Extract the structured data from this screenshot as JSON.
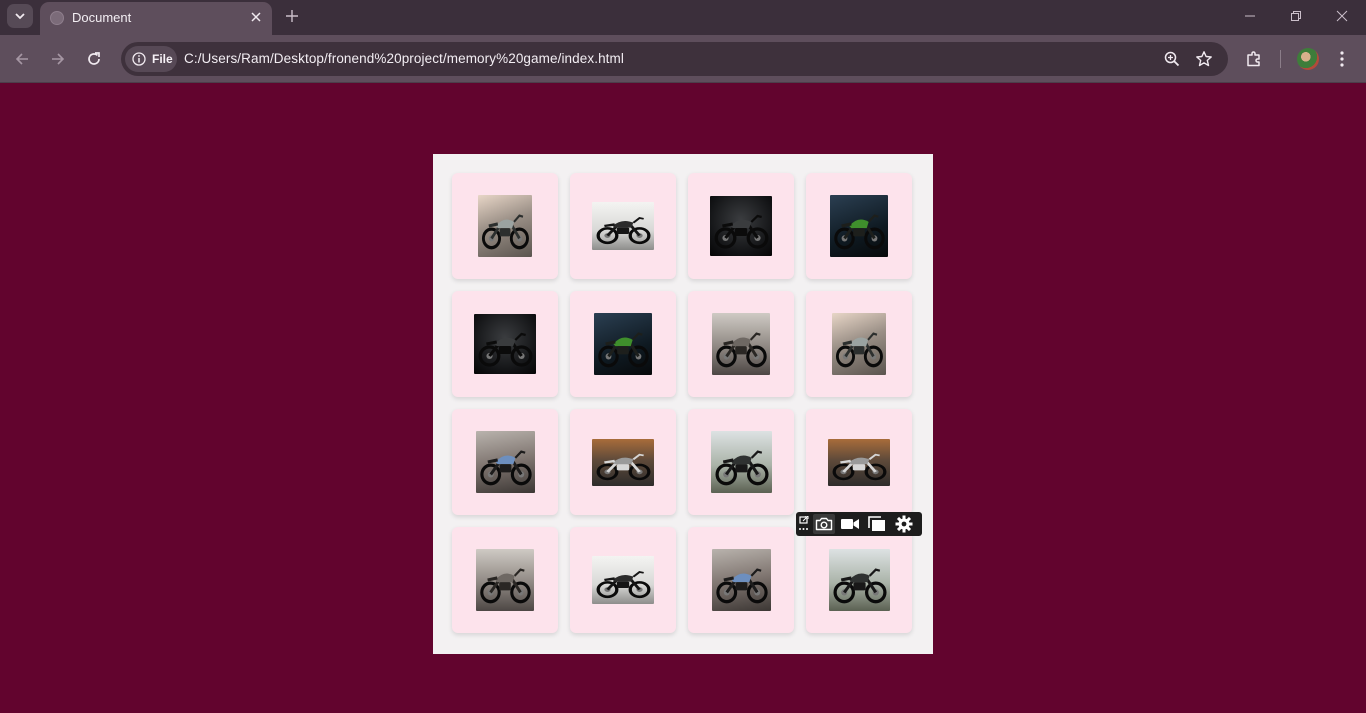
{
  "browser": {
    "tab_title": "Document",
    "site_chip_label": "File",
    "url": "C:/Users/Ram/Desktop/fronend%20project/memory%20game/index.html"
  },
  "colors": {
    "page_background": "#62042e",
    "board_background": "#f3f1f2",
    "card_background": "#fde3ec"
  },
  "icons": {
    "tabstrip": [
      "tab-search-icon",
      "tab-close-icon",
      "new-tab-icon",
      "minimize-icon",
      "restore-icon",
      "window-close-icon"
    ],
    "toolbar": [
      "back-icon",
      "forward-icon",
      "reload-icon",
      "info-icon",
      "zoom-icon",
      "bookmark-star-icon",
      "extensions-icon",
      "profile-avatar",
      "menu-icon"
    ],
    "capture_toolbar": [
      "popout-icon",
      "camera-icon",
      "video-icon",
      "window-icon",
      "settings-icon"
    ]
  },
  "game": {
    "cards": [
      {
        "image": "vintage-cafe-racer-silver"
      },
      {
        "image": "black-streetfighter-white-bg"
      },
      {
        "image": "black-classic-studio"
      },
      {
        "image": "green-sportbike-dark"
      },
      {
        "image": "black-classic-studio"
      },
      {
        "image": "green-sportbike-dark"
      },
      {
        "image": "grey-cruiser-hills"
      },
      {
        "image": "vintage-cafe-racer-silver"
      },
      {
        "image": "blue-tank-classic"
      },
      {
        "image": "silver-sportbike-sunset"
      },
      {
        "image": "black-streetfighter-outdoor"
      },
      {
        "image": "silver-sportbike-sunset"
      },
      {
        "image": "grey-cruiser-hills"
      },
      {
        "image": "black-streetfighter-white-bg"
      },
      {
        "image": "blue-tank-classic"
      },
      {
        "image": "black-streetfighter-outdoor"
      }
    ]
  }
}
